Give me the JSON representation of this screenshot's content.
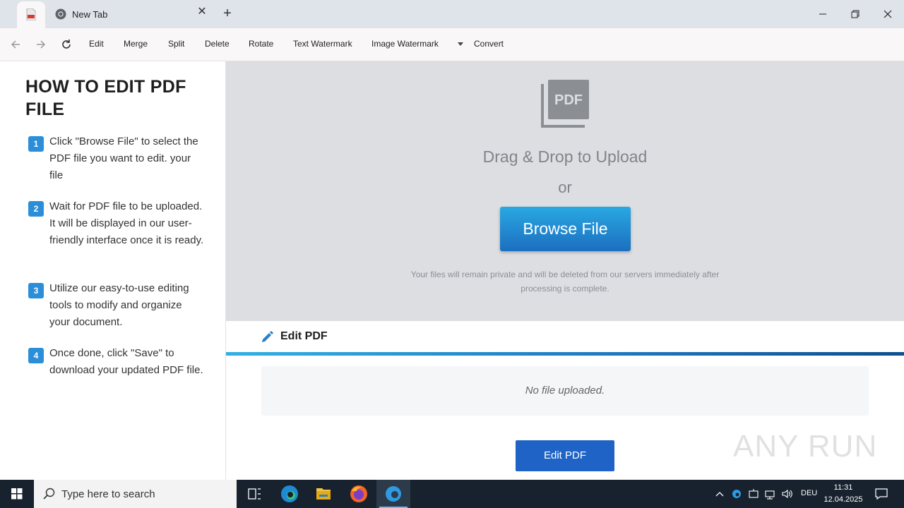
{
  "browser": {
    "tabs": [
      {
        "title": "",
        "icon": "pdf-icon",
        "active": true
      },
      {
        "title": "New Tab",
        "icon": "chrome-icon",
        "active": false
      }
    ],
    "new_tab_symbol": "+",
    "close_tab_symbol": "✕"
  },
  "toolbar": {
    "items": [
      "Edit",
      "Merge",
      "Split",
      "Delete",
      "Rotate",
      "Text Watermark",
      "Image Watermark"
    ],
    "convert": "Convert"
  },
  "guide": {
    "title": "HOW TO EDIT PDF FILE",
    "steps": [
      {
        "num": "1",
        "text": "Click \"Browse File\" to select the PDF file you want to edit. your file"
      },
      {
        "num": "2",
        "text": "Wait for PDF file to be uploaded. It will be displayed in our user-friendly interface once it is ready."
      },
      {
        "num": "3",
        "text": "Utilize our easy-to-use editing tools to modify and organize your document."
      },
      {
        "num": "4",
        "text": "Once done, click \"Save\" to download your updated PDF file."
      }
    ]
  },
  "upload": {
    "icon_label": "PDF",
    "drag_drop": "Drag & Drop to Upload",
    "or": "or",
    "browse": "Browse File",
    "privacy": "Your files will remain private and will be deleted from our servers immediately after processing is complete."
  },
  "editor": {
    "header": "Edit PDF",
    "status": "No file uploaded.",
    "button": "Edit PDF"
  },
  "watermark": "ANY RUN",
  "taskbar": {
    "search_placeholder": "Type here to search",
    "language": "DEU",
    "time": "11:31",
    "date": "12.04.2025"
  },
  "colors": {
    "accent_blue": "#1e63c5",
    "step_badge": "#2b8ed8",
    "upload_bg": "#dcdee2"
  }
}
